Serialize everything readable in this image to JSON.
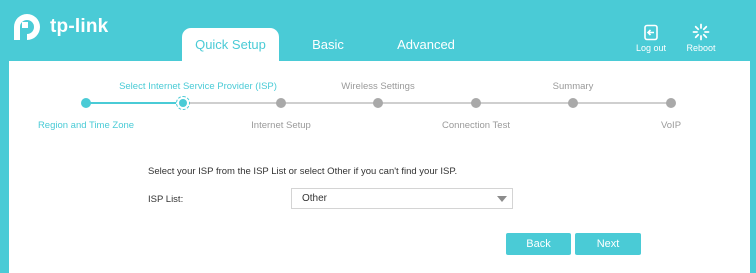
{
  "brand": {
    "name": "tp-link"
  },
  "tabs": [
    {
      "label": "Quick Setup",
      "active": true
    },
    {
      "label": "Basic",
      "active": false
    },
    {
      "label": "Advanced",
      "active": false
    }
  ],
  "actions": {
    "logout_label": "Log out",
    "reboot_label": "Reboot"
  },
  "progress": {
    "steps": [
      {
        "label": "Region and Time Zone",
        "state": "done"
      },
      {
        "label": "Select Internet Service Provider (ISP)",
        "state": "current"
      },
      {
        "label": "Internet Setup",
        "state": "todo"
      },
      {
        "label": "Wireless Settings",
        "state": "todo"
      },
      {
        "label": "Connection Test",
        "state": "todo"
      },
      {
        "label": "Summary",
        "state": "todo"
      },
      {
        "label": "VoIP",
        "state": "todo"
      }
    ]
  },
  "form": {
    "instruction": "Select your ISP from the ISP List or select Other if you can't find your ISP.",
    "isp_label": "ISP List:",
    "isp_selected": "Other"
  },
  "buttons": {
    "back": "Back",
    "next": "Next"
  },
  "colors": {
    "accent": "#4acbd6",
    "inactive_dot": "#a9a9a9",
    "inactive_text": "#9a9a9a"
  }
}
